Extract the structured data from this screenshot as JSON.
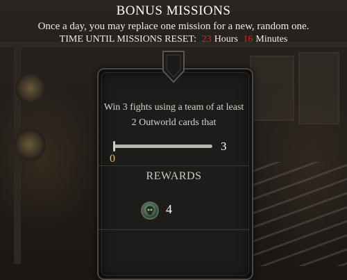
{
  "header": {
    "title": "BONUS MISSIONS",
    "subtitle": "Once a day, you may replace one mission for a new, random one.",
    "timer_label": "TIME UNTIL MISSIONS RESET:",
    "hours_value": "23",
    "hours_label": "Hours",
    "minutes_value": "16",
    "minutes_label": "Minutes"
  },
  "mission": {
    "description": "Win 3 fights using a team of at least 2 Outworld cards that",
    "progress_current": "0",
    "progress_max": "3",
    "progress_fraction": 0
  },
  "rewards": {
    "label": "REWARDS",
    "icon": "koin-skull-icon",
    "amount": "4"
  },
  "colors": {
    "accent_red": "#e02020",
    "progress_yellow": "#e8c25a"
  }
}
